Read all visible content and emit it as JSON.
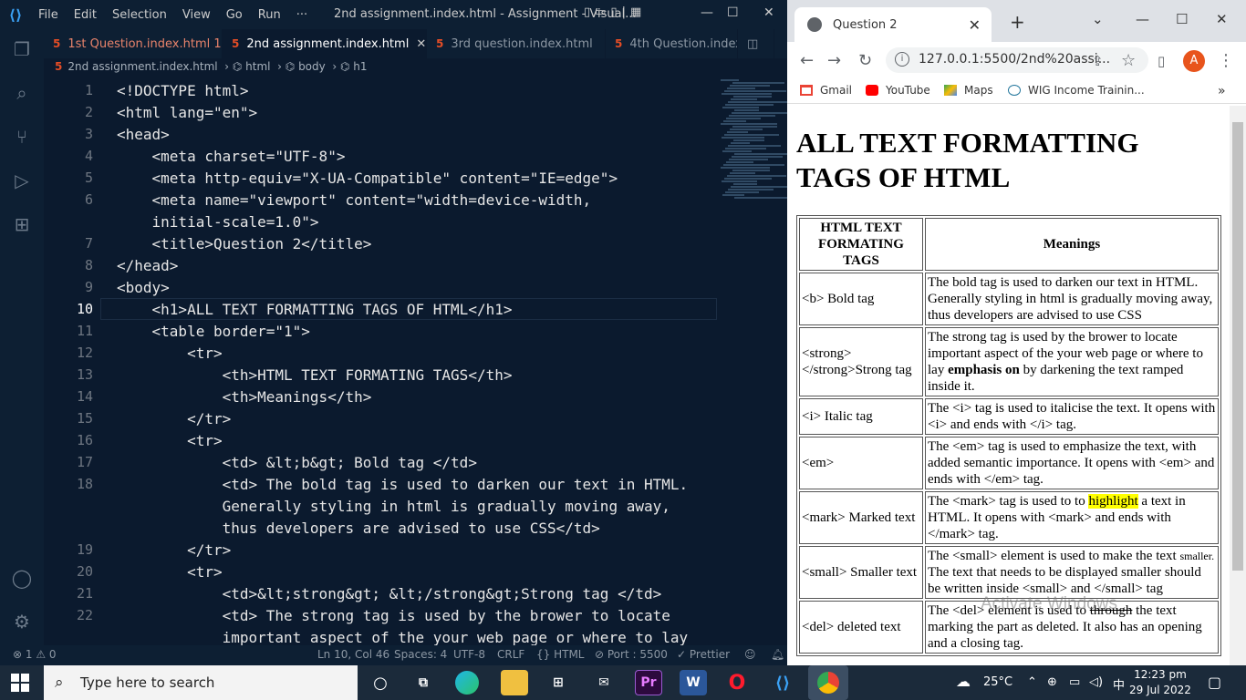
{
  "vscode": {
    "menu": [
      "File",
      "Edit",
      "Selection",
      "View",
      "Go",
      "Run",
      "···"
    ],
    "window_title": "2nd assignment.index.html - Assignment - Visual...",
    "tabs": [
      {
        "label": "1st Question.index.html",
        "badge": "1",
        "state": "modified"
      },
      {
        "label": "2nd assignment.index.html",
        "state": "active"
      },
      {
        "label": "3rd question.index.html",
        "state": "plain"
      },
      {
        "label": "4th Question.index.",
        "state": "plain"
      }
    ],
    "breadcrumb": [
      "2nd assignment.index.html",
      "html",
      "body",
      "h1"
    ],
    "current_line": "10",
    "gutter": [
      "1",
      "2",
      "3",
      "4",
      "5",
      "6",
      "",
      "7",
      "8",
      "9",
      "10",
      "11",
      "12",
      "13",
      "14",
      "15",
      "16",
      "17",
      "18",
      "",
      "",
      "19",
      "20",
      "21",
      "22"
    ],
    "code_lines": [
      "<!DOCTYPE html>",
      "<html lang=\"en\">",
      "<head>",
      "    <meta charset=\"UTF-8\">",
      "    <meta http-equiv=\"X-UA-Compatible\" content=\"IE=edge\">",
      "    <meta name=\"viewport\" content=\"width=device-width,",
      "    initial-scale=1.0\">",
      "    <title>Question 2</title>",
      "</head>",
      "<body>",
      "    <h1>ALL TEXT FORMATTING TAGS OF HTML</h1>",
      "    <table border=\"1\">",
      "        <tr>",
      "            <th>HTML TEXT FORMATING TAGS</th>",
      "            <th>Meanings</th>",
      "        </tr>",
      "        <tr>",
      "            <td> &lt;b&gt; Bold tag </td>",
      "            <td> The bold tag is used to darken our text in HTML.",
      "            Generally styling in html is gradually moving away,",
      "            thus developers are advised to use CSS</td>",
      "        </tr>",
      "        <tr>",
      "            <td>&lt;strong&gt; &lt;/strong&gt;Strong tag </td>",
      "            <td> The strong tag is used by the brower to locate",
      "            important aspect of the your web page or where to lay"
    ],
    "status": {
      "problems": "⊗ 1 ⚠ 0",
      "position": "Ln 10, Col 46",
      "spaces": "Spaces: 4",
      "encoding": "UTF-8",
      "eol": "CRLF",
      "language": "{} HTML",
      "port": "⊘ Port : 5500",
      "prettier": "✓ Prettier"
    }
  },
  "chrome": {
    "tab_title": "Question 2",
    "url": "127.0.0.1:5500/2nd%20assi...",
    "avatar": "A",
    "bookmarks": [
      "Gmail",
      "YouTube",
      "Maps",
      "WIG Income Trainin..."
    ],
    "page": {
      "heading": "ALL TEXT FORMATTING TAGS OF HTML",
      "headers": [
        "HTML TEXT FORMATING TAGS",
        "Meanings"
      ],
      "rows": [
        {
          "tag": "<b> Bold tag",
          "meaning": "The bold tag is used to darken our text in HTML. Generally styling in html is gradually moving away, thus developers are advised to use CSS"
        },
        {
          "tag": "<strong> </strong>Strong tag",
          "meaning_before": "The strong tag is used by the brower to locate important aspect of the your web page or where to lay ",
          "meaning_bold": "emphasis on",
          "meaning_after": " by darkening the text ramped inside it."
        },
        {
          "tag": "<i> Italic tag",
          "meaning": "The <i> tag is used to italicise the text. It opens with <i> and ends with </i> tag."
        },
        {
          "tag": "<em>",
          "meaning": "The <em> tag is used to emphasize the text, with added semantic importance. It opens with <em> and ends with </em> tag."
        },
        {
          "tag": "<mark> Marked text",
          "meaning_before": "The <mark> tag is used to to ",
          "meaning_mark": "highlight",
          "meaning_after": " a text in HTML. It opens with <mark> and ends with </mark> tag."
        },
        {
          "tag": "<small> Smaller text",
          "meaning_before": "The <small> element is used to make the text ",
          "meaning_small": "smaller.",
          "meaning_after": " The text that needs to be displayed smaller should be written inside <small> and </small> tag"
        },
        {
          "tag": "<del> deleted text",
          "meaning_before": "The <del> element is used to ",
          "meaning_del": "through",
          "meaning_after": " the text marking the part as deleted. It also has an opening and a closing tag."
        }
      ]
    }
  },
  "watermark": "Activate Windows",
  "taskbar": {
    "search_placeholder": "Type here to search",
    "temperature": "25°C",
    "time": "12:23 pm",
    "date": "29 Jul 2022"
  }
}
